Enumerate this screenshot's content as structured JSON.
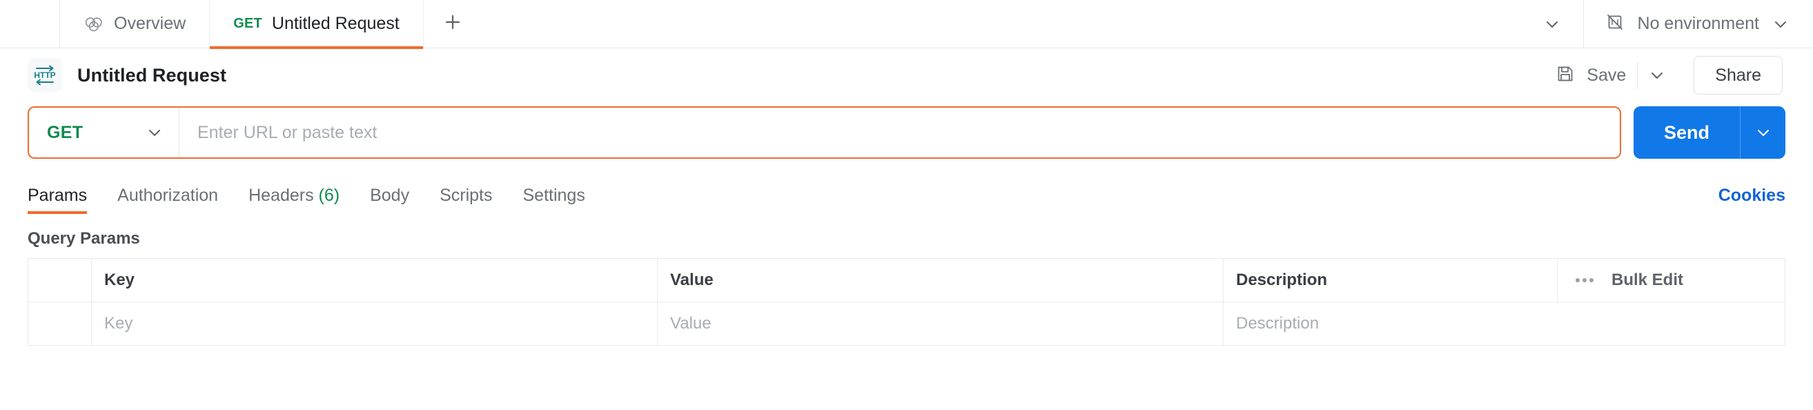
{
  "colors": {
    "accent_orange": "#ef6c2f",
    "send_blue": "#1178e8",
    "link_blue": "#1463d8",
    "method_green": "#118a4e"
  },
  "tabbar": {
    "overview_tab": {
      "label": "Overview",
      "icon": "overview-circles-icon"
    },
    "request_tab": {
      "method": "GET",
      "label": "Untitled Request",
      "active": true
    },
    "new_tab_icon": "plus-icon",
    "tabs_overflow_icon": "chevron-down-icon",
    "environment": {
      "label": "No environment",
      "icon": "no-environment-icon",
      "chevron_icon": "chevron-down-icon"
    }
  },
  "request_header": {
    "icon": "http-protocol-icon",
    "icon_text": "HTTP",
    "title": "Untitled Request",
    "save_label": "Save",
    "save_icon": "floppy-disk-icon",
    "save_chevron_icon": "chevron-down-icon",
    "share_label": "Share"
  },
  "url_bar": {
    "method": "GET",
    "method_chevron_icon": "chevron-down-icon",
    "url_value": "",
    "url_placeholder": "Enter URL or paste text",
    "send_label": "Send",
    "send_chevron_icon": "chevron-down-icon"
  },
  "section_tabs": {
    "items": [
      {
        "label": "Params",
        "active": true,
        "count": ""
      },
      {
        "label": "Authorization",
        "active": false,
        "count": ""
      },
      {
        "label": "Headers",
        "active": false,
        "count": "(6)"
      },
      {
        "label": "Body",
        "active": false,
        "count": ""
      },
      {
        "label": "Scripts",
        "active": false,
        "count": ""
      },
      {
        "label": "Settings",
        "active": false,
        "count": ""
      }
    ],
    "cookies_label": "Cookies"
  },
  "query_params": {
    "section_title": "Query Params",
    "columns": [
      "",
      "Key",
      "Value",
      "Description"
    ],
    "header_key": "Key",
    "header_value": "Value",
    "header_description": "Description",
    "bulk_edit_label": "Bulk Edit",
    "bulk_edit_icon": "ellipsis-icon",
    "rows": [
      {
        "key_placeholder": "Key",
        "value_placeholder": "Value",
        "description_placeholder": "Description"
      }
    ]
  }
}
